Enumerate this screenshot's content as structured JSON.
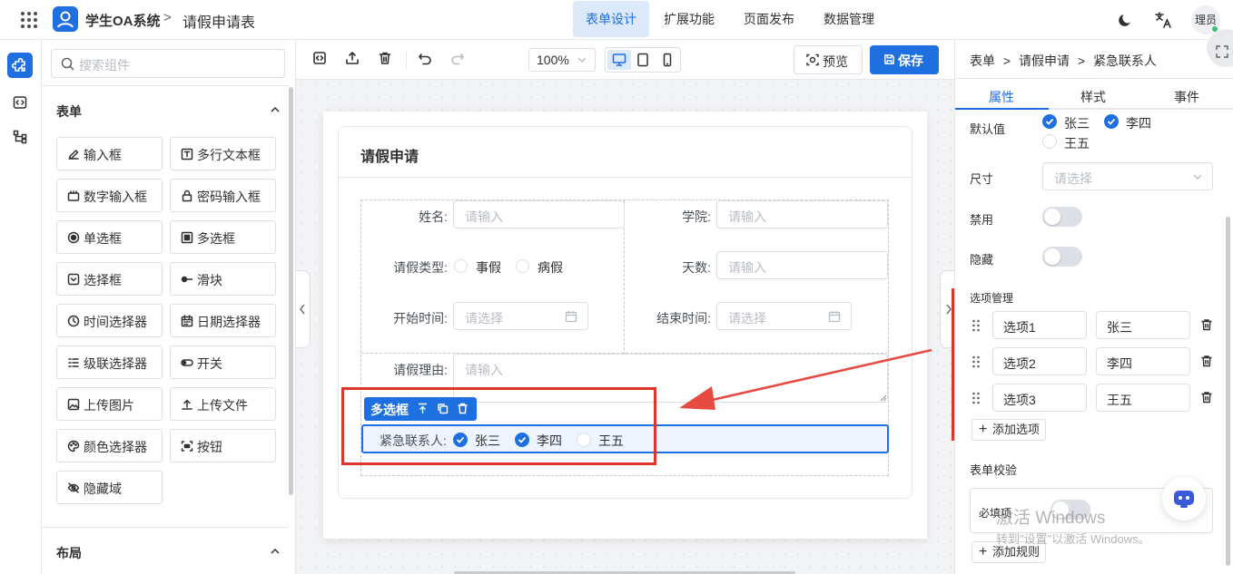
{
  "header": {
    "app_title": "学生OA系统",
    "breadcrumb_sep": ">",
    "page_title": "请假申请表",
    "nav_tabs": [
      "表单设计",
      "扩展功能",
      "页面发布",
      "数据管理"
    ],
    "active_tab": "表单设计",
    "user_label": "理员"
  },
  "components": {
    "search_placeholder": "搜索组件",
    "section_form": "表单",
    "items": [
      "输入框",
      "多行文本框",
      "数字输入框",
      "密码输入框",
      "单选框",
      "多选框",
      "选择框",
      "滑块",
      "时间选择器",
      "日期选择器",
      "级联选择器",
      "开关",
      "上传图片",
      "上传文件",
      "颜色选择器",
      "按钮",
      "隐藏域"
    ],
    "section_layout": "布局"
  },
  "toolbar": {
    "zoom": "100%",
    "preview_label": "预览",
    "save_label": "保存"
  },
  "form": {
    "title": "请假申请",
    "name_label": "姓名:",
    "name_placeholder": "请输入",
    "college_label": "学院:",
    "college_placeholder": "请输入",
    "leave_type_label": "请假类型:",
    "leave_type_options": [
      "事假",
      "病假"
    ],
    "days_label": "天数:",
    "days_placeholder": "请输入",
    "start_label": "开始时间:",
    "start_placeholder": "请选择",
    "end_label": "结束时间:",
    "end_placeholder": "请选择",
    "reason_label": "请假理由:",
    "reason_placeholder": "请输入",
    "selected_tag": "多选框",
    "contact_label": "紧急联系人:",
    "contacts": [
      {
        "label": "张三",
        "checked": true
      },
      {
        "label": "李四",
        "checked": true
      },
      {
        "label": "王五",
        "checked": false
      }
    ]
  },
  "props": {
    "breadcrumb": [
      "表单",
      "请假申请",
      "紧急联系人"
    ],
    "tabs": [
      "属性",
      "样式",
      "事件"
    ],
    "active_tab": "属性",
    "default_label": "默认值",
    "default_values": [
      {
        "label": "张三",
        "checked": true
      },
      {
        "label": "李四",
        "checked": true
      },
      {
        "label": "王五",
        "checked": false
      }
    ],
    "size_label": "尺寸",
    "size_placeholder": "请选择",
    "disabled_label": "禁用",
    "disabled_on": false,
    "hidden_label": "隐藏",
    "hidden_on": false,
    "options_label": "选项管理",
    "options": [
      {
        "value": "选项1",
        "label": "张三"
      },
      {
        "value": "选项2",
        "label": "李四"
      },
      {
        "value": "选项3",
        "label": "王五"
      }
    ],
    "add_option": "添加选项",
    "validation_label": "表单校验",
    "required_label": "必填项",
    "add_rule": "添加规则"
  },
  "watermark": {
    "line1": "激活 Windows",
    "line2": "转到\"设置\"以激活 Windows。"
  },
  "colors": {
    "primary": "#1e6fe0",
    "highlight_border": "#e0352b",
    "arrow": "#e64a40"
  }
}
